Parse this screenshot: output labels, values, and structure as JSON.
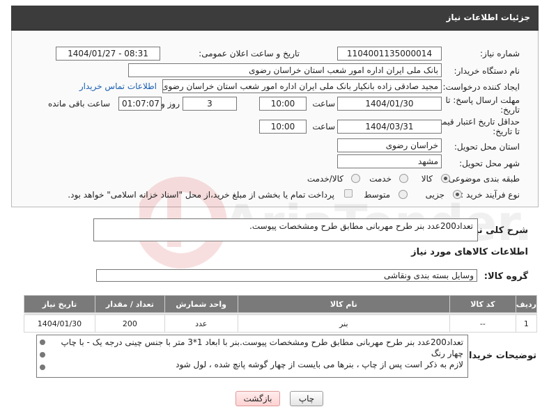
{
  "header": {
    "title": "جزئیات اطلاعات نیاز"
  },
  "need_number": {
    "label": "شماره نیاز:",
    "value": "1104001135000014"
  },
  "announce": {
    "label": "تاریخ و ساعت اعلان عمومی:",
    "value": "1404/01/27 - 08:31"
  },
  "buyer_org": {
    "label": "نام دستگاه خریدار:",
    "value": "بانک ملی ایران اداره امور شعب استان خراسان رضوی"
  },
  "requester": {
    "label": "ایجاد کننده درخواست:",
    "value": "مجید صادقی زاده بانکیار بانک ملی ایران اداره امور شعب استان خراسان رضوی",
    "contact_link": "اطلاعات تماس خریدار"
  },
  "deadline": {
    "label_line1": "مهلت ارسال پاسخ: تا",
    "label_line2": "تاریخ:",
    "date": "1404/01/30",
    "time_label": "ساعت",
    "time": "10:00",
    "days": "3",
    "days_label": "روز و",
    "remaining": "01:07:07",
    "remaining_label": "ساعت باقی مانده"
  },
  "validity": {
    "label_line1": "حداقل تاریخ اعتبار قیمت:",
    "label_line2": "تا تاریخ:",
    "date": "1404/03/31",
    "time_label": "ساعت",
    "time": "10:00"
  },
  "province": {
    "label": "استان محل تحویل:",
    "value": "خراسان رضوی"
  },
  "city": {
    "label": "شهر محل تحویل:",
    "value": "مشهد"
  },
  "category": {
    "label": "طبقه بندی موضوعی:",
    "options": [
      "کالا",
      "خدمت",
      "کالا/خدمت"
    ],
    "selected": "کالا"
  },
  "process": {
    "label": "نوع فرآیند خرید :",
    "options": [
      "جزیی",
      "متوسط"
    ],
    "selected": "جزیی",
    "note": "پرداخت تمام یا بخشی از مبلغ خرید،از محل \"اسناد خزانه اسلامی\" خواهد بود."
  },
  "description": {
    "label": "شرح کلی نیاز:",
    "value": "تعداد200عدد بنر طرح مهربانی مطابق طرح ومشخصات پیوست."
  },
  "goods_section": {
    "title": "اطلاعات کالاهای مورد نیاز"
  },
  "goods_group": {
    "label": "گروه کالا:",
    "value": "وسایل بسته بندی  ونقاشی"
  },
  "table": {
    "columns": [
      "ردیف",
      "کد کالا",
      "نام کالا",
      "واحد شمارش",
      "تعداد / مقدار",
      "تاریخ نیاز"
    ],
    "rows": [
      [
        "1",
        "--",
        "بنر",
        "عدد",
        "200",
        "1404/01/30"
      ]
    ]
  },
  "buyer_notes": {
    "label": "توضیحات خریدار:",
    "lines": [
      "تعداد200عدد بنر طرح مهربانی مطابق طرح ومشخصات پیوست.بنر با ابعاد  1*3 متر  با جنس چینی درجه یک  - با چاپ",
      "چهار رنگ",
      "لازم به ذکر است پس از چاپ ، بنرها می بایست از چهار گوشه پانچ شده ، لول شود"
    ]
  },
  "buttons": {
    "print": "چاپ",
    "back": "بازگشت"
  },
  "colors": {
    "header_bg": "#3c3c3c",
    "table_header_bg": "#7a7a7a",
    "link": "#1a5fb4",
    "back_button": "#ffd2d2"
  }
}
